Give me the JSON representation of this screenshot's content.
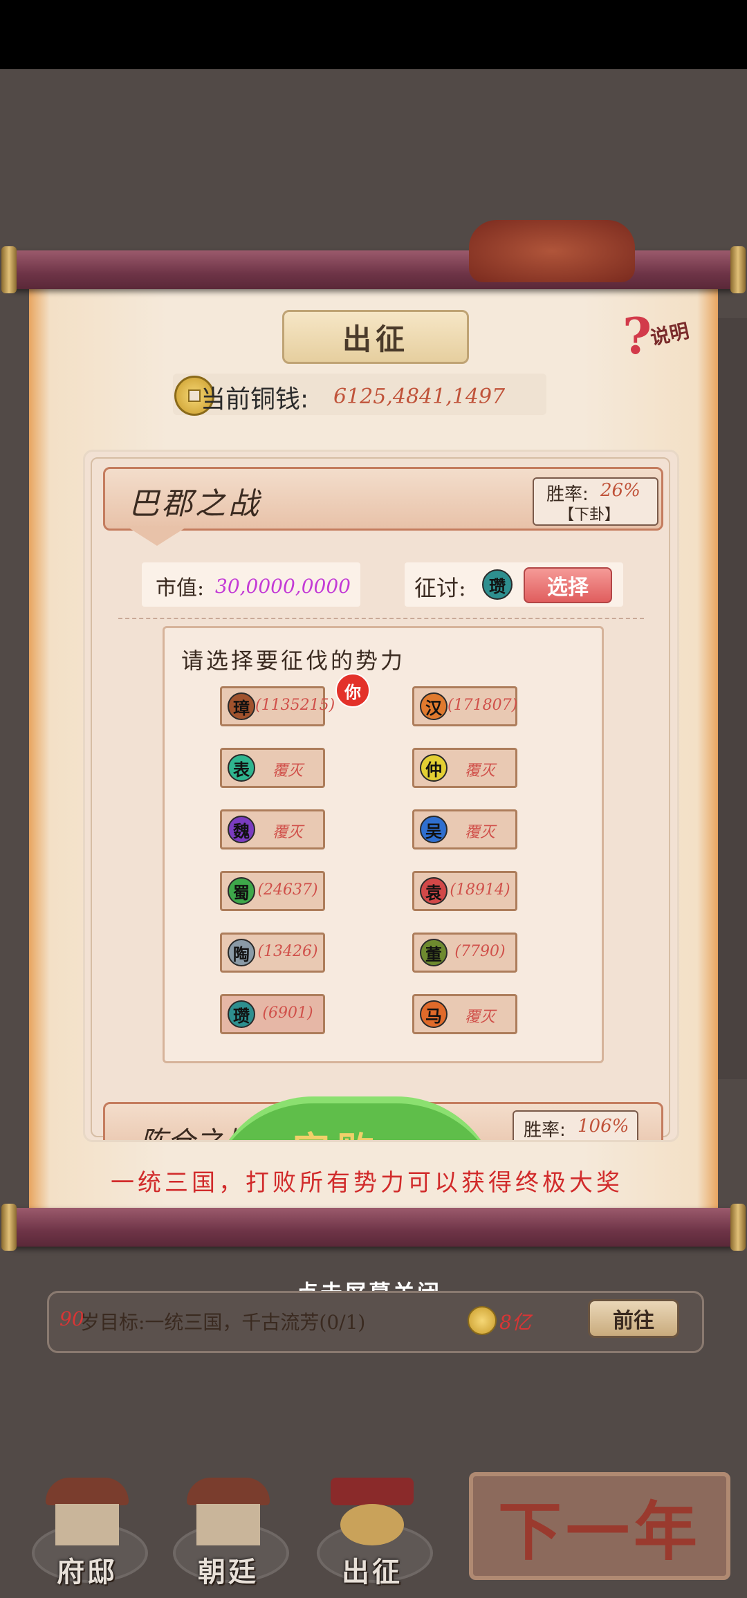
{
  "panel": {
    "title": "出征",
    "help_label": "说明",
    "help_icon": "?",
    "coin_label": "当前铜钱:",
    "coin_value": "6125,4841,1497"
  },
  "battle": {
    "name": "巴郡之战",
    "winrate_label": "胜率:",
    "winrate_value": "26%",
    "winrate_tag": "【下卦】",
    "market_label": "市值:",
    "market_value": "30,0000,0000",
    "conquer_label": "征讨:",
    "conquer_faction": "瓒",
    "choose_label": "选择"
  },
  "select": {
    "title": "请选择要征伐的势力",
    "you_badge": "你",
    "factions": [
      {
        "name": "璋",
        "value": "(1135215)",
        "color": "#a0522d"
      },
      {
        "name": "汉",
        "value": "(171807)",
        "color": "#e07a2e"
      },
      {
        "name": "表",
        "value": "覆灭",
        "color": "#2fb58f"
      },
      {
        "name": "仲",
        "value": "覆灭",
        "color": "#e3cf33"
      },
      {
        "name": "魏",
        "value": "覆灭",
        "color": "#7a3cc0"
      },
      {
        "name": "吴",
        "value": "覆灭",
        "color": "#2f6fd0"
      },
      {
        "name": "蜀",
        "value": "(24637)",
        "color": "#3ea84a"
      },
      {
        "name": "袁",
        "value": "(18914)",
        "color": "#d24848"
      },
      {
        "name": "陶",
        "value": "(13426)",
        "color": "#8a9aa6"
      },
      {
        "name": "董",
        "value": "(7790)",
        "color": "#6e8a2f"
      },
      {
        "name": "瓒",
        "value": "(6901)",
        "color": "#2e8f8f"
      },
      {
        "name": "马",
        "value": "覆灭",
        "color": "#e06a2a"
      }
    ]
  },
  "next_battle": {
    "name": "陈仓之战",
    "result": "完败",
    "winrate_label": "胜率:",
    "winrate_value": "106%"
  },
  "slogan": "一统三国，打败所有势力可以获得终极大奖",
  "close_hint": "点击屏幕关闭",
  "goal": {
    "age": "90",
    "text": "岁目标:一统三国，千古流芳(0/1)",
    "reward": "8亿",
    "goto_label": "前往"
  },
  "nav": {
    "mansion": "府邸",
    "court": "朝廷",
    "expedition": "出征",
    "next_year": "下一年"
  },
  "colors": {
    "accent_red": "#d12b2b",
    "rod": "#6e3447",
    "paper": "#f5e9da"
  }
}
